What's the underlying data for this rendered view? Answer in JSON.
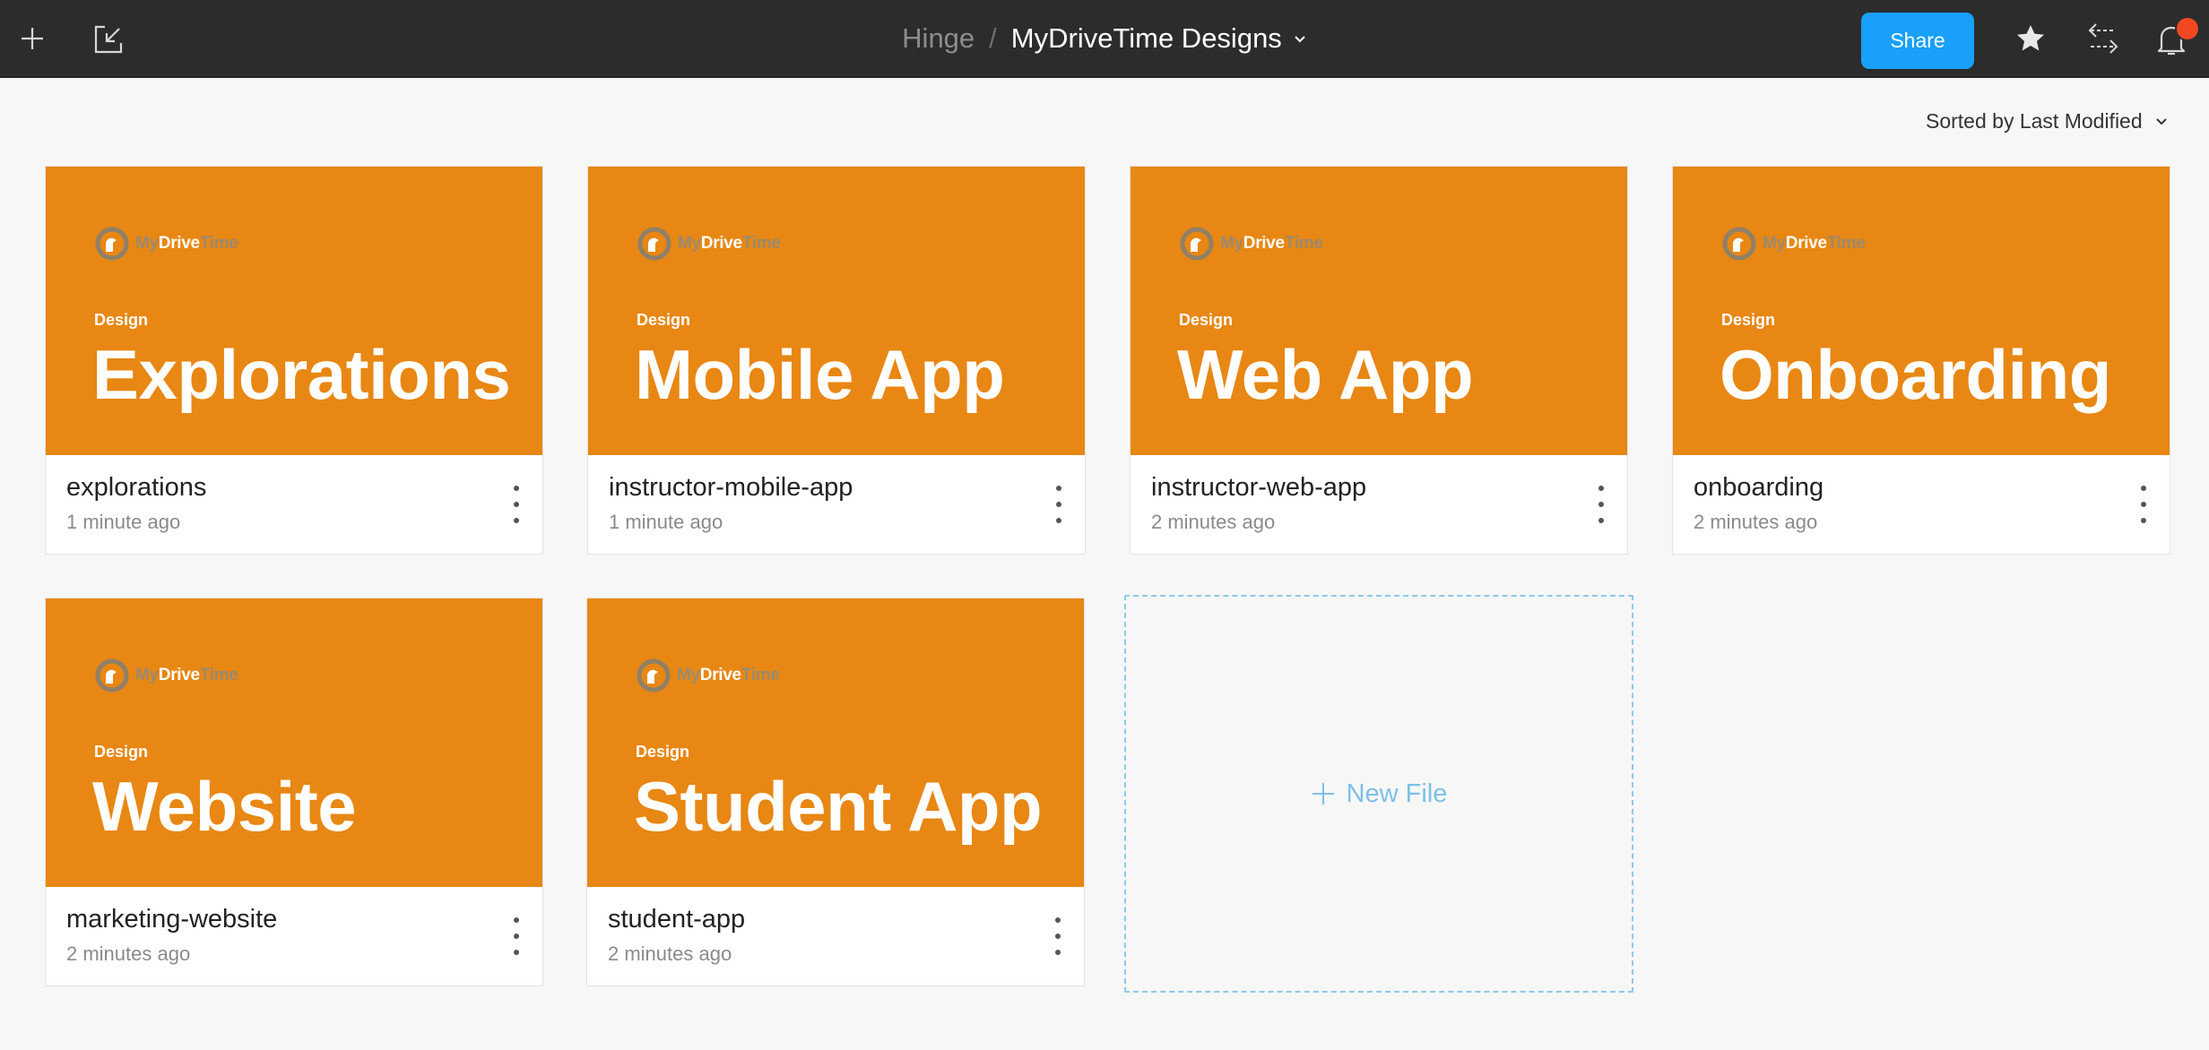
{
  "topbar": {
    "new_icon": "plus-icon",
    "import_icon": "import-icon",
    "team": "Hinge",
    "separator": "/",
    "project": "MyDriveTime Designs",
    "share_label": "Share",
    "star_icon": "star-icon",
    "move_icon": "move-icon",
    "bell_icon": "bell-icon",
    "accent": "#18a0fb",
    "notification_color": "#f24822"
  },
  "sort": {
    "label": "Sorted by Last Modified"
  },
  "thumbnail": {
    "background": "#e88713",
    "logo_my": "My",
    "logo_drive": "Drive",
    "logo_time": "Time",
    "kicker": "Design"
  },
  "files": [
    {
      "title": "Explorations",
      "name": "explorations",
      "modified": "1 minute ago"
    },
    {
      "title": "Mobile App",
      "name": "instructor-mobile-app",
      "modified": "1 minute ago"
    },
    {
      "title": "Web App",
      "name": "instructor-web-app",
      "modified": "2 minutes ago"
    },
    {
      "title": "Onboarding",
      "name": "onboarding",
      "modified": "2 minutes ago"
    },
    {
      "title": "Website",
      "name": "marketing-website",
      "modified": "2 minutes ago"
    },
    {
      "title": "Student App",
      "name": "student-app",
      "modified": "2 minutes ago"
    }
  ],
  "new_file": {
    "label": "New File"
  }
}
